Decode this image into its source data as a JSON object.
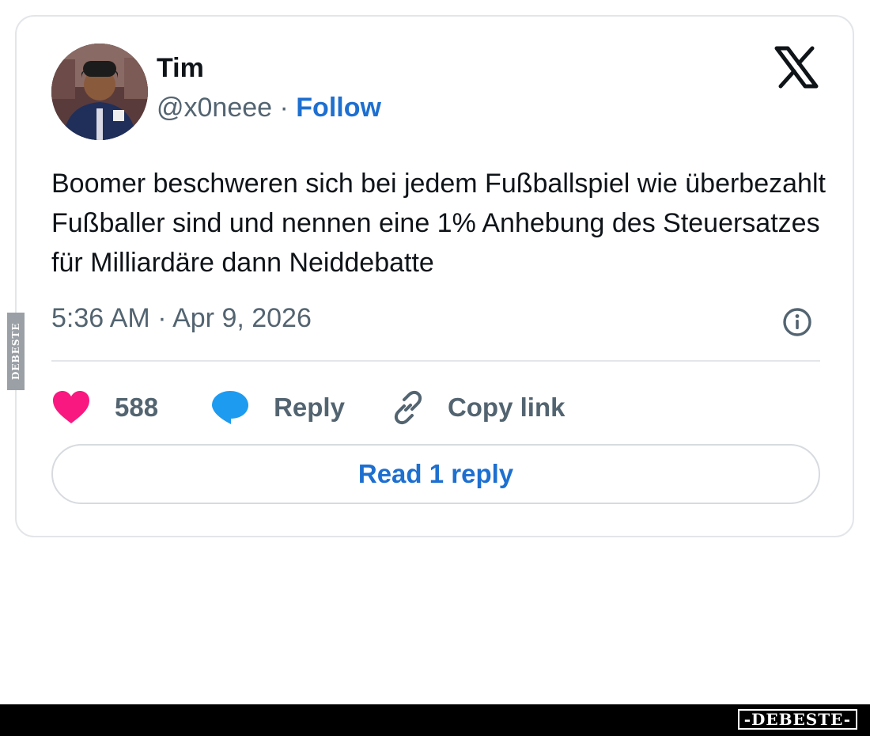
{
  "tweet": {
    "author_name": "Tim",
    "handle": "@x0neee",
    "separator": " · ",
    "follow_label": "Follow",
    "text": "Boomer beschweren sich bei jedem Fußballspiel wie überbezahlt Fußballer sind und nennen eine 1% Anhebung des Steuersatzes für Milliardäre dann Neiddebatte",
    "timestamp": "5:36 AM · Apr 9, 2026",
    "like_count": "588",
    "reply_label": "Reply",
    "copy_link_label": "Copy link",
    "read_replies_label": "Read 1 reply"
  },
  "icons": {
    "logo": "x-logo-icon",
    "info": "info-icon",
    "like": "heart-icon",
    "reply": "speech-bubble-icon",
    "copy": "link-icon"
  },
  "colors": {
    "accent": "#1d6fd0",
    "heart": "#f91880",
    "reply_bubble": "#1d9bf0",
    "muted": "#536471"
  },
  "watermark": {
    "side": "DEBESTE",
    "footer": "-DEBESTE-"
  }
}
